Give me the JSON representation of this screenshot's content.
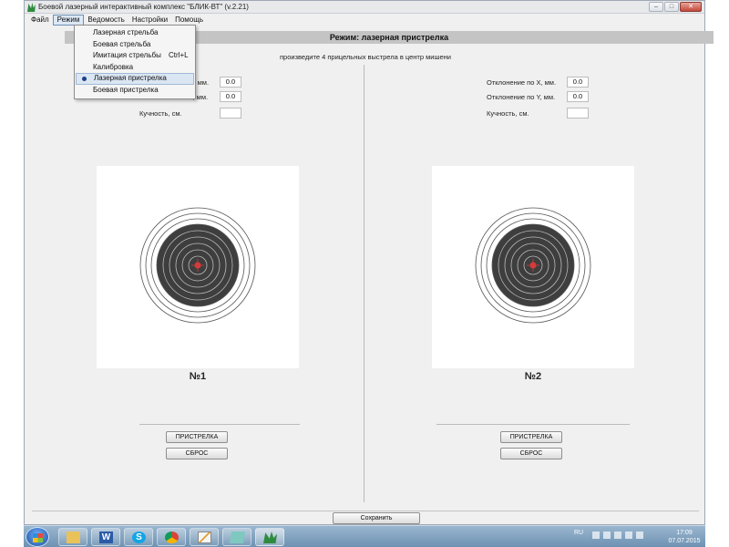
{
  "window": {
    "title": "Боевой лазерный интерактивный комплекс \"БЛИК-ВТ\" (v.2.21)",
    "controls": {
      "minimize": "–",
      "maximize": "□",
      "close": "✕"
    }
  },
  "menubar": {
    "items": [
      "Файл",
      "Режим",
      "Ведомость",
      "Настройки",
      "Помощь"
    ],
    "active": "Режим"
  },
  "dropdown": {
    "items": [
      {
        "label": "Лазерная стрельба",
        "shortcut": ""
      },
      {
        "label": "Боевая стрельба",
        "shortcut": ""
      },
      {
        "label": "Имитация стрельбы",
        "shortcut": "Ctrl+L"
      },
      {
        "label": "Калибровка",
        "shortcut": ""
      },
      {
        "label": "Лазерная пристрелка",
        "shortcut": "",
        "selected": true
      },
      {
        "label": "Боевая пристрелка",
        "shortcut": ""
      }
    ]
  },
  "mode": {
    "title": "Режим: лазерная пристрелка",
    "instruction": "произведите 4 прицельных выстрела в центр мишени"
  },
  "panels": {
    "left": {
      "dev_x_label": "Отклонение по X, мм.",
      "dev_x_value": "0.0",
      "dev_y_label": "Отклонение по Y, мм.",
      "dev_y_value": "0.0",
      "grouping_label": "Кучность, см.",
      "grouping_value": "",
      "target_label": "№1",
      "zero_button": "ПРИСТРЕЛКА",
      "reset_button": "СБРОС"
    },
    "right": {
      "dev_x_label": "Отклонение по X, мм.",
      "dev_x_value": "0.0",
      "dev_y_label": "Отклонение по Y, мм.",
      "dev_y_value": "0.0",
      "grouping_label": "Кучность, см.",
      "grouping_value": "",
      "target_label": "№2",
      "zero_button": "ПРИСТРЕЛКА",
      "reset_button": "СБРОС"
    }
  },
  "footer": {
    "save_button": "Сохранить"
  },
  "taskbar": {
    "apps": [
      "explorer-icon",
      "word-icon",
      "skype-icon",
      "chrome-icon",
      "editor-icon",
      "notes-icon",
      "blik-app-icon"
    ],
    "language": "RU",
    "time": "17:09",
    "date": "07.07.2015"
  }
}
